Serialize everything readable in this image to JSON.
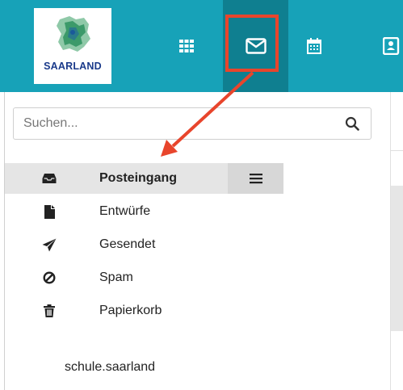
{
  "header": {
    "logo_text": "SAARLAND",
    "nav": [
      {
        "name": "apps",
        "icon": "grid-icon"
      },
      {
        "name": "mail",
        "icon": "envelope-icon",
        "active": true
      },
      {
        "name": "calendar",
        "icon": "calendar-icon"
      },
      {
        "name": "contacts",
        "icon": "address-book-icon"
      }
    ]
  },
  "search": {
    "placeholder": "Suchen..."
  },
  "folders": [
    {
      "label": "Posteingang",
      "icon": "inbox-icon",
      "active": true
    },
    {
      "label": "Entwürfe",
      "icon": "file-icon"
    },
    {
      "label": "Gesendet",
      "icon": "paper-plane-icon"
    },
    {
      "label": "Spam",
      "icon": "ban-icon"
    },
    {
      "label": "Papierkorb",
      "icon": "trash-icon"
    }
  ],
  "account": {
    "name": "schule.saarland"
  },
  "colors": {
    "topbar": "#17a2b8",
    "active_nav": "#0f7f90",
    "annotation": "#e8452c"
  }
}
